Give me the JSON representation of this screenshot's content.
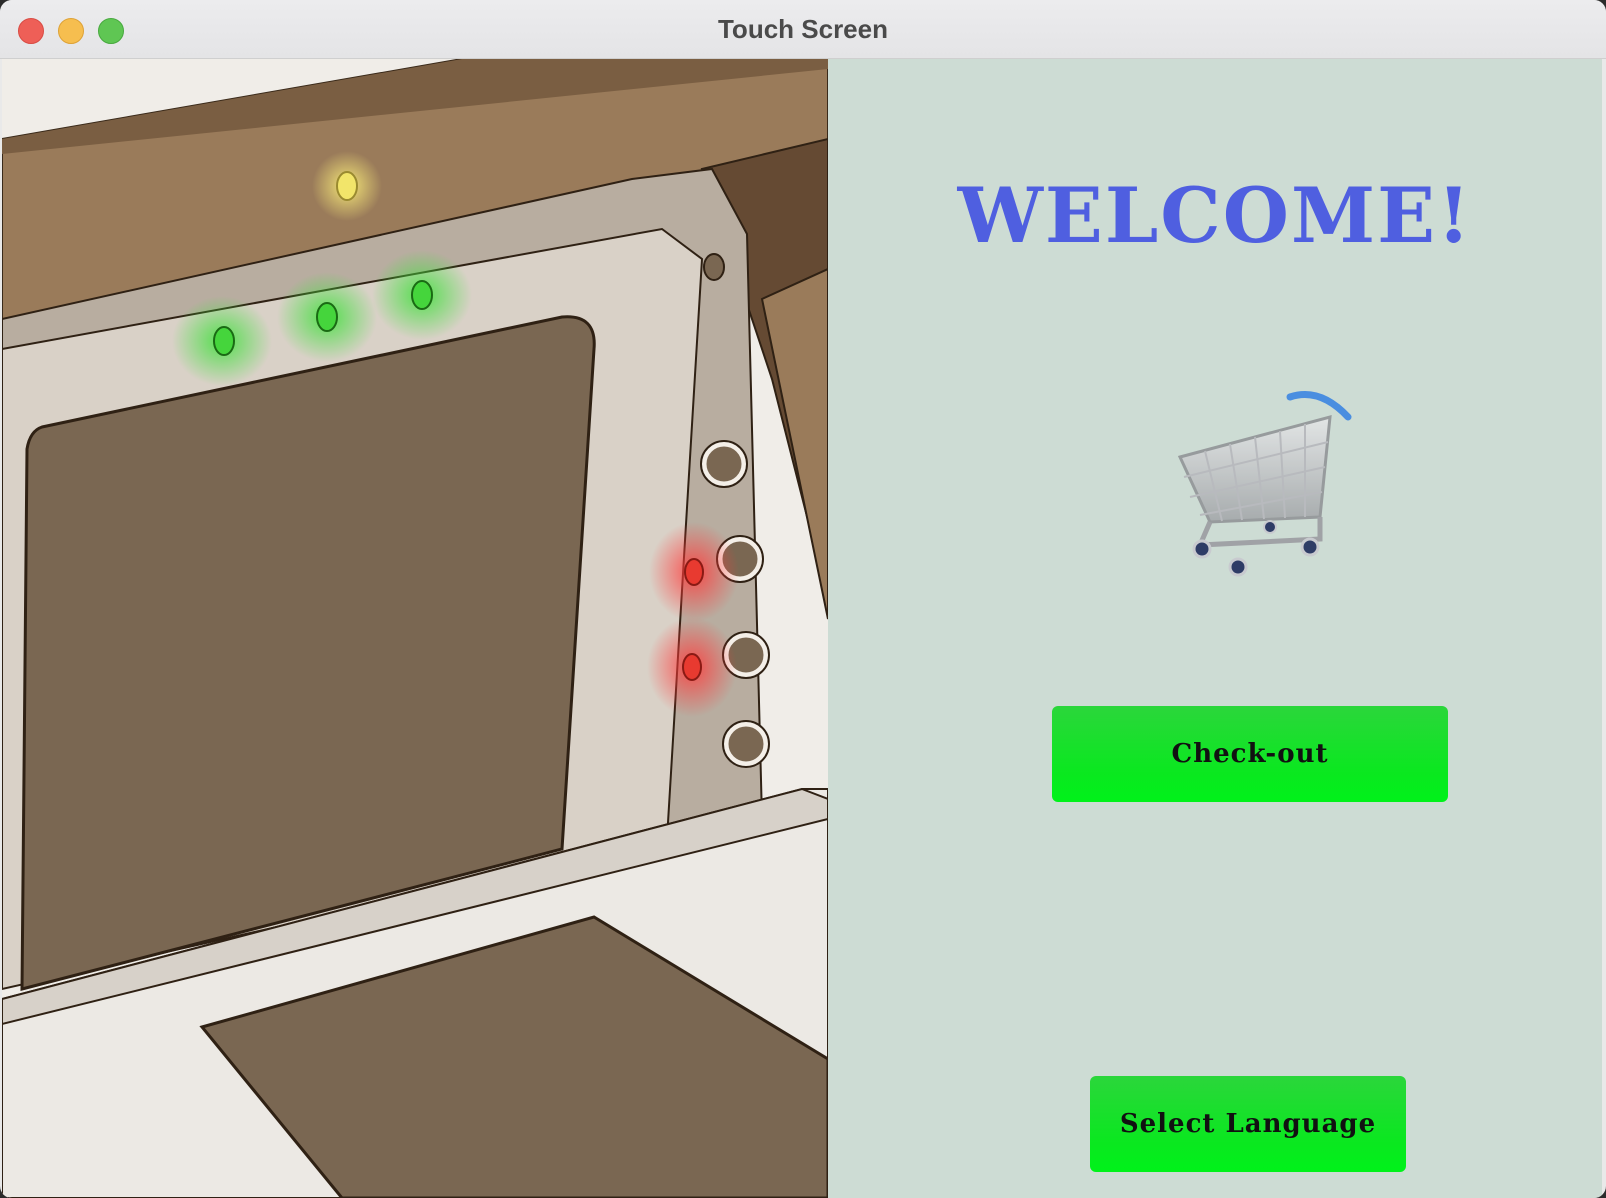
{
  "window": {
    "title": "Touch Screen"
  },
  "main": {
    "heading": "WELCOME!",
    "cart_icon": "shopping-cart-icon",
    "checkout_label": "Check-out",
    "language_label": "Select Language"
  },
  "colors": {
    "accent": "#4f5fe0",
    "button": "#0ae81f",
    "panel": "#cddcd4"
  }
}
